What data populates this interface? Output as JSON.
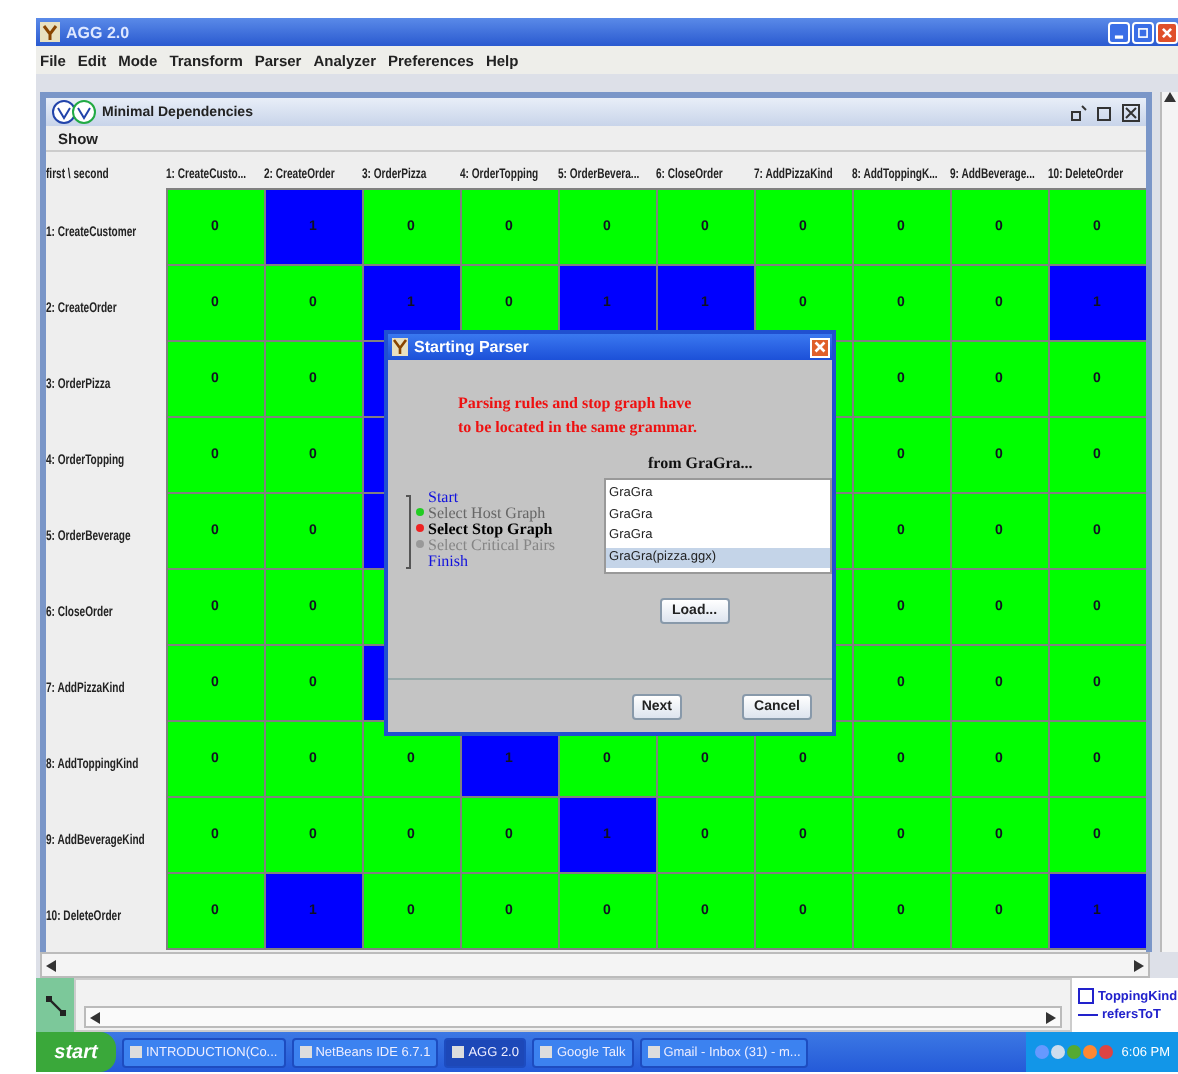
{
  "window": {
    "title": "AGG 2.0"
  },
  "menu": [
    "File",
    "Edit",
    "Mode",
    "Transform",
    "Parser",
    "Analyzer",
    "Preferences",
    "Help"
  ],
  "frame": {
    "title": "Minimal Dependencies",
    "menu": [
      "Show"
    ]
  },
  "table": {
    "corner": "first \\ second",
    "columns": [
      "1: CreateCusto...",
      "2: CreateOrder",
      "3: OrderPizza",
      "4: OrderTopping",
      "5: OrderBevera...",
      "6: CloseOrder",
      "7: AddPizzaKind",
      "8: AddToppingK...",
      "9: AddBeverage...",
      "10: DeleteOrder"
    ],
    "rows": [
      {
        "label": "1: CreateCustomer",
        "cells": [
          {
            "value": "0",
            "color": "#00ff00"
          },
          {
            "value": "1",
            "color": "#0000ff"
          },
          {
            "value": "0",
            "color": "#00ff00"
          },
          {
            "value": "0",
            "color": "#00ff00"
          },
          {
            "value": "0",
            "color": "#00ff00"
          },
          {
            "value": "0",
            "color": "#00ff00"
          },
          {
            "value": "0",
            "color": "#00ff00"
          },
          {
            "value": "0",
            "color": "#00ff00"
          },
          {
            "value": "0",
            "color": "#00ff00"
          },
          {
            "value": "0",
            "color": "#00ff00"
          }
        ]
      },
      {
        "label": "2: CreateOrder",
        "cells": [
          {
            "value": "0",
            "color": "#00ff00"
          },
          {
            "value": "0",
            "color": "#00ff00"
          },
          {
            "value": "1",
            "color": "#0000ff"
          },
          {
            "value": "0",
            "color": "#00ff00"
          },
          {
            "value": "1",
            "color": "#0000ff"
          },
          {
            "value": "1",
            "color": "#0000ff"
          },
          {
            "value": "0",
            "color": "#00ff00"
          },
          {
            "value": "0",
            "color": "#00ff00"
          },
          {
            "value": "0",
            "color": "#00ff00"
          },
          {
            "value": "1",
            "color": "#0000ff"
          }
        ]
      },
      {
        "label": "3: OrderPizza",
        "cells": [
          {
            "value": "0",
            "color": "#00ff00"
          },
          {
            "value": "0",
            "color": "#00ff00"
          },
          {
            "color": "#0000ff"
          },
          null,
          null,
          null,
          {
            "color": "#00ff00"
          },
          {
            "value": "0",
            "color": "#00ff00"
          },
          {
            "value": "0",
            "color": "#00ff00"
          },
          {
            "value": "0",
            "color": "#00ff00"
          }
        ]
      },
      {
        "label": "4: OrderTopping",
        "cells": [
          {
            "value": "0",
            "color": "#00ff00"
          },
          {
            "value": "0",
            "color": "#00ff00"
          },
          {
            "color": "#0000ff"
          },
          null,
          null,
          null,
          {
            "color": "#00ff00"
          },
          {
            "value": "0",
            "color": "#00ff00"
          },
          {
            "value": "0",
            "color": "#00ff00"
          },
          {
            "value": "0",
            "color": "#00ff00"
          }
        ]
      },
      {
        "label": "5: OrderBeverage",
        "cells": [
          {
            "value": "0",
            "color": "#00ff00"
          },
          {
            "value": "0",
            "color": "#00ff00"
          },
          {
            "color": "#0000ff"
          },
          null,
          null,
          null,
          {
            "color": "#00ff00"
          },
          {
            "value": "0",
            "color": "#00ff00"
          },
          {
            "value": "0",
            "color": "#00ff00"
          },
          {
            "value": "0",
            "color": "#00ff00"
          }
        ]
      },
      {
        "label": "6: CloseOrder",
        "cells": [
          {
            "value": "0",
            "color": "#00ff00"
          },
          {
            "value": "0",
            "color": "#00ff00"
          },
          {
            "color": "#00ff00"
          },
          null,
          null,
          null,
          {
            "color": "#00ff00"
          },
          {
            "value": "0",
            "color": "#00ff00"
          },
          {
            "value": "0",
            "color": "#00ff00"
          },
          {
            "value": "0",
            "color": "#00ff00"
          }
        ]
      },
      {
        "label": "7: AddPizzaKind",
        "cells": [
          {
            "value": "0",
            "color": "#00ff00"
          },
          {
            "value": "0",
            "color": "#00ff00"
          },
          {
            "color": "#0000ff"
          },
          null,
          null,
          null,
          {
            "color": "#00ff00"
          },
          {
            "value": "0",
            "color": "#00ff00"
          },
          {
            "value": "0",
            "color": "#00ff00"
          },
          {
            "value": "0",
            "color": "#00ff00"
          }
        ]
      },
      {
        "label": "8: AddToppingKind",
        "cells": [
          {
            "value": "0",
            "color": "#00ff00"
          },
          {
            "value": "0",
            "color": "#00ff00"
          },
          {
            "value": "0",
            "color": "#00ff00"
          },
          {
            "value": "1",
            "color": "#0000ff"
          },
          {
            "value": "0",
            "color": "#00ff00"
          },
          {
            "value": "0",
            "color": "#00ff00"
          },
          {
            "value": "0",
            "color": "#00ff00"
          },
          {
            "value": "0",
            "color": "#00ff00"
          },
          {
            "value": "0",
            "color": "#00ff00"
          },
          {
            "value": "0",
            "color": "#00ff00"
          }
        ]
      },
      {
        "label": "9: AddBeverageKind",
        "cells": [
          {
            "value": "0",
            "color": "#00ff00"
          },
          {
            "value": "0",
            "color": "#00ff00"
          },
          {
            "value": "0",
            "color": "#00ff00"
          },
          {
            "value": "0",
            "color": "#00ff00"
          },
          {
            "value": "1",
            "color": "#0000ff"
          },
          {
            "value": "0",
            "color": "#00ff00"
          },
          {
            "value": "0",
            "color": "#00ff00"
          },
          {
            "value": "0",
            "color": "#00ff00"
          },
          {
            "value": "0",
            "color": "#00ff00"
          },
          {
            "value": "0",
            "color": "#00ff00"
          }
        ]
      },
      {
        "label": "10: DeleteOrder",
        "cells": [
          {
            "value": "0",
            "color": "#00ff00"
          },
          {
            "value": "1",
            "color": "#0000ff"
          },
          {
            "value": "0",
            "color": "#00ff00"
          },
          {
            "value": "0",
            "color": "#00ff00"
          },
          {
            "value": "0",
            "color": "#00ff00"
          },
          {
            "value": "0",
            "color": "#00ff00"
          },
          {
            "value": "0",
            "color": "#00ff00"
          },
          {
            "value": "0",
            "color": "#00ff00"
          },
          {
            "value": "0",
            "color": "#00ff00"
          },
          {
            "value": "1",
            "color": "#0000ff"
          }
        ]
      }
    ]
  },
  "dialog": {
    "title": "Starting Parser",
    "message": [
      "Parsing rules and stop graph have",
      "to be located in the same grammar."
    ],
    "list_label": "from GraGra...",
    "steps": [
      {
        "kind": "terminal",
        "label": "Start"
      },
      {
        "kind": "stage",
        "label": "Select Host Graph",
        "done": true,
        "selected": false,
        "disabled": false
      },
      {
        "kind": "stage",
        "label": "Select Stop Graph",
        "done": false,
        "selected": true,
        "disabled": false
      },
      {
        "kind": "stage",
        "label": "Select Critical Pairs",
        "done": false,
        "selected": false,
        "disabled": true
      },
      {
        "kind": "terminal",
        "label": "Finish"
      }
    ],
    "grammars": [
      {
        "label": "GraGra",
        "selected": false
      },
      {
        "label": "GraGra",
        "selected": false
      },
      {
        "label": "GraGra",
        "selected": false
      },
      {
        "label": "GraGra(pizza.ggx)",
        "selected": true
      }
    ],
    "load_button": "Load...",
    "buttons": [
      "Next",
      "Cancel"
    ]
  },
  "legend": [
    {
      "kind": "node",
      "label": "ToppingKind"
    },
    {
      "kind": "edge",
      "label": "refersToT"
    }
  ],
  "taskbar": {
    "start": "start",
    "items": [
      {
        "label": "INTRODUCTION(Co...",
        "selected": false
      },
      {
        "label": "NetBeans IDE 6.7.1",
        "selected": false
      },
      {
        "label": "AGG 2.0",
        "selected": true
      },
      {
        "label": "Google Talk",
        "selected": false
      },
      {
        "label": "Gmail - Inbox (31) - m...",
        "selected": false
      }
    ],
    "clock": "6:06 PM"
  }
}
